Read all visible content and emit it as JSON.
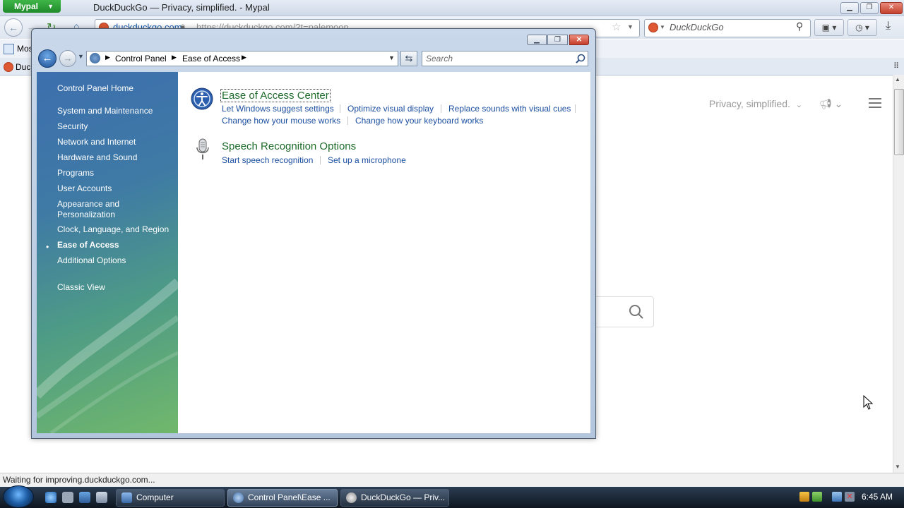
{
  "browser": {
    "app_button": "Mypal",
    "title": "DuckDuckGo — Privacy, simplified. - Mypal",
    "url_domain": "duckduckgo.com",
    "url_text": "https://duckduckgo.com/?t=palemoon",
    "search_engine": "DuckDuckGo",
    "bookmark_first": "Mos",
    "tab_first": "Duc",
    "status": "Waiting for improving.duckduckgo.com...",
    "page": {
      "menu_label": "Privacy, simplified."
    }
  },
  "control_panel": {
    "breadcrumb": [
      "Control Panel",
      "Ease of Access"
    ],
    "search_placeholder": "Search",
    "sidebar": {
      "home": "Control Panel Home",
      "items": [
        "System and Maintenance",
        "Security",
        "Network and Internet",
        "Hardware and Sound",
        "Programs",
        "User Accounts",
        "Appearance and Personalization",
        "Clock, Language, and Region",
        "Ease of Access",
        "Additional Options"
      ],
      "active_item": "Ease of Access",
      "classic_view": "Classic View"
    },
    "categories": [
      {
        "title": "Ease of Access Center",
        "icon": "ease-of-access-icon",
        "tasks": [
          "Let Windows suggest settings",
          "Optimize visual display",
          "Replace sounds with visual cues",
          "Change how your mouse works",
          "Change how your keyboard works"
        ]
      },
      {
        "title": "Speech Recognition Options",
        "icon": "microphone-icon",
        "tasks": [
          "Start speech recognition",
          "Set up a microphone"
        ]
      }
    ]
  },
  "taskbar": {
    "buttons": [
      {
        "label": "Computer",
        "icon": "computer-icon"
      },
      {
        "label": "Control Panel\\Ease ...",
        "icon": "control-panel-icon",
        "active": true
      },
      {
        "label": "DuckDuckGo — Priv...",
        "icon": "browser-icon"
      }
    ],
    "clock": "6:45 AM"
  }
}
